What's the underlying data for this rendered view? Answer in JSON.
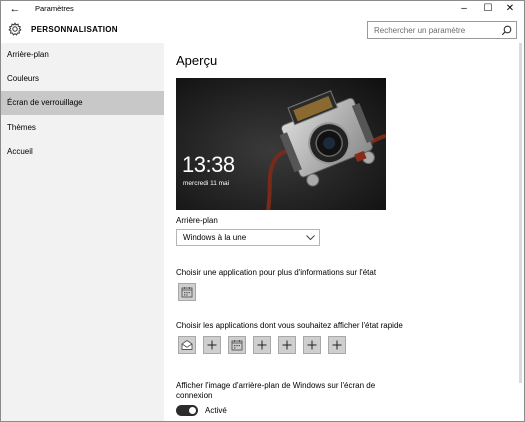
{
  "window": {
    "title": "Paramètres",
    "back_glyph": "←",
    "minimize_glyph": "–",
    "maximize_glyph": "☐",
    "close_glyph": "✕"
  },
  "header": {
    "icon": "gear-icon",
    "title": "PERSONNALISATION",
    "search_placeholder": "Rechercher un paramètre"
  },
  "sidebar": {
    "items": [
      {
        "label": "Arrière-plan",
        "active": false
      },
      {
        "label": "Couleurs",
        "active": false
      },
      {
        "label": "Écran de verrouillage",
        "active": true
      },
      {
        "label": "Thèmes",
        "active": false
      },
      {
        "label": "Accueil",
        "active": false
      }
    ]
  },
  "main": {
    "preview_heading": "Aperçu",
    "preview": {
      "time": "13:38",
      "date": "mercredi 11 mai"
    },
    "background": {
      "label": "Arrière-plan",
      "selected": "Windows à la une"
    },
    "detailed_status": {
      "label": "Choisir une application pour plus d'informations sur l'état",
      "apps": [
        "calendar-icon"
      ]
    },
    "quick_status": {
      "label": "Choisir les applications dont vous souhaitez afficher l'état rapide",
      "apps": [
        "mail-icon",
        "plus-icon",
        "calendar-icon",
        "plus-icon",
        "plus-icon",
        "plus-icon",
        "plus-icon"
      ]
    },
    "show_background": {
      "label_line1": "Afficher l'image d'arrière-plan de Windows sur l'écran de",
      "label_line2": "connexion",
      "toggle_state": "Activé",
      "on": true
    }
  },
  "colors": {
    "sidebar_bg": "#f2f2f2",
    "sidebar_active": "#c8c8c8",
    "toggle_on": "#2b2b2b"
  }
}
